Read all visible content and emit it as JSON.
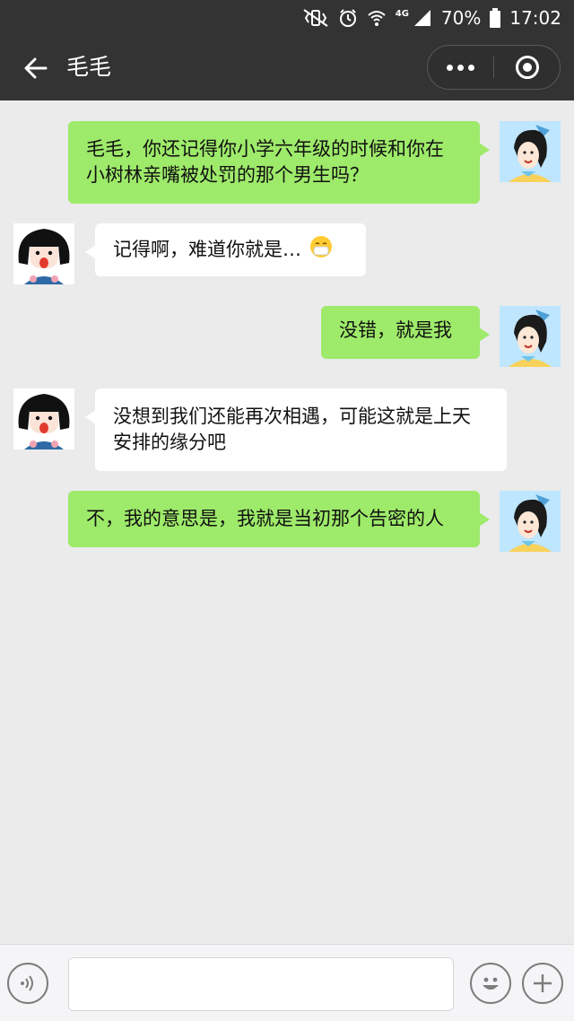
{
  "status_bar": {
    "network": "4G",
    "battery": "70%",
    "time": "17:02",
    "icons": [
      "mute-vibrate-icon",
      "alarm-icon",
      "wifi-icon",
      "signal-icon",
      "battery-icon"
    ]
  },
  "header": {
    "title": "毛毛",
    "icons": [
      "back-arrow-icon",
      "more-dots-icon",
      "close-target-icon"
    ]
  },
  "messages": [
    {
      "side": "right",
      "text": "毛毛，你还记得你小学六年级的时候和你在小树林亲嘴被处罚的那个男生吗？"
    },
    {
      "side": "left",
      "text": "记得啊，难道你就是…",
      "emoji": "mask-emoji-icon"
    },
    {
      "side": "right",
      "text": "没错，就是我"
    },
    {
      "side": "left",
      "text": "没想到我们还能再次相遇，可能这就是上天安排的缘分吧"
    },
    {
      "side": "right",
      "text": "不，我的意思是，我就是当初那个告密的人"
    }
  ],
  "input_bar": {
    "value": "",
    "icons": [
      "voice-icon",
      "emoji-icon",
      "plus-icon"
    ]
  },
  "colors": {
    "top_bar": "#333333",
    "chat_bg": "#ebebeb",
    "bubble_right": "#9eea6a",
    "bubble_left": "#ffffff"
  }
}
